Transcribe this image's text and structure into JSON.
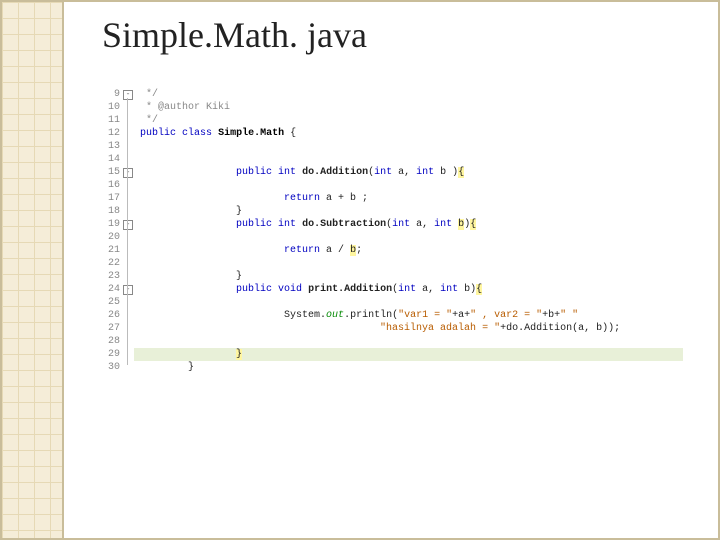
{
  "slide": {
    "title": "Simple.Math. java"
  },
  "editor": {
    "firstLine": 9,
    "lastLine": 30,
    "cursorLine": 29,
    "foldMarkers": [
      {
        "line": 9,
        "glyph": "-"
      },
      {
        "line": 15,
        "glyph": "-"
      },
      {
        "line": 19,
        "glyph": "-"
      },
      {
        "line": 24,
        "glyph": "-"
      }
    ],
    "lines": {
      "9": {
        "indent": 0,
        "tokens": [
          {
            "t": " */",
            "c": "cm"
          }
        ]
      },
      "10": {
        "indent": 0,
        "tokens": [
          {
            "t": " * @author Kiki",
            "c": "cm"
          }
        ]
      },
      "11": {
        "indent": 0,
        "tokens": [
          {
            "t": " */",
            "c": "cm"
          }
        ]
      },
      "12": {
        "indent": 0,
        "tokens": [
          {
            "t": "public",
            "c": "kw"
          },
          {
            "t": " "
          },
          {
            "t": "class",
            "c": "kw"
          },
          {
            "t": " "
          },
          {
            "t": "Simple.Math",
            "c": "typ"
          },
          {
            "t": " {"
          }
        ]
      },
      "13": {
        "indent": 0,
        "tokens": []
      },
      "14": {
        "indent": 0,
        "tokens": []
      },
      "15": {
        "indent": 2,
        "tokens": [
          {
            "t": "public",
            "c": "kw"
          },
          {
            "t": " "
          },
          {
            "t": "int",
            "c": "kw"
          },
          {
            "t": " "
          },
          {
            "t": "do.Addition",
            "c": "meth"
          },
          {
            "t": "("
          },
          {
            "t": "int",
            "c": "kw"
          },
          {
            "t": " a, "
          },
          {
            "t": "int",
            "c": "kw"
          },
          {
            "t": " b "
          },
          {
            "t": ")",
            "c": ""
          },
          {
            "t": "{",
            "c": "hl"
          }
        ]
      },
      "16": {
        "indent": 2,
        "tokens": []
      },
      "17": {
        "indent": 3,
        "tokens": [
          {
            "t": "return",
            "c": "kw"
          },
          {
            "t": " a + b ;"
          }
        ]
      },
      "18": {
        "indent": 2,
        "tokens": [
          {
            "t": "}"
          }
        ]
      },
      "19": {
        "indent": 2,
        "tokens": [
          {
            "t": "public",
            "c": "kw"
          },
          {
            "t": " "
          },
          {
            "t": "int",
            "c": "kw"
          },
          {
            "t": " "
          },
          {
            "t": "do.Subtraction",
            "c": "meth"
          },
          {
            "t": "("
          },
          {
            "t": "int",
            "c": "kw"
          },
          {
            "t": " a, "
          },
          {
            "t": "int",
            "c": "kw"
          },
          {
            "t": " "
          },
          {
            "t": "b",
            "c": "hl"
          },
          {
            "t": ")"
          },
          {
            "t": "{",
            "c": "hl"
          }
        ]
      },
      "20": {
        "indent": 2,
        "tokens": []
      },
      "21": {
        "indent": 3,
        "tokens": [
          {
            "t": "return",
            "c": "kw"
          },
          {
            "t": " a / "
          },
          {
            "t": "b",
            "c": "hl"
          },
          {
            "t": ";"
          }
        ]
      },
      "22": {
        "indent": 2,
        "tokens": []
      },
      "23": {
        "indent": 2,
        "tokens": [
          {
            "t": "}"
          }
        ]
      },
      "24": {
        "indent": 2,
        "tokens": [
          {
            "t": "public",
            "c": "kw"
          },
          {
            "t": " "
          },
          {
            "t": "void",
            "c": "kw"
          },
          {
            "t": " "
          },
          {
            "t": "print.Addition",
            "c": "meth"
          },
          {
            "t": "("
          },
          {
            "t": "int",
            "c": "kw"
          },
          {
            "t": " a, "
          },
          {
            "t": "int",
            "c": "kw"
          },
          {
            "t": " b)"
          },
          {
            "t": "{",
            "c": "hl"
          }
        ]
      },
      "25": {
        "indent": 2,
        "tokens": []
      },
      "26": {
        "indent": 3,
        "tokens": [
          {
            "t": "System."
          },
          {
            "t": "out",
            "c": "fld"
          },
          {
            "t": ".println("
          },
          {
            "t": "\"var1 = \"",
            "c": "str"
          },
          {
            "t": "+a+"
          },
          {
            "t": "\" , var2 = \"",
            "c": "str"
          },
          {
            "t": "+b+"
          },
          {
            "t": "\" \"",
            "c": "str"
          }
        ]
      },
      "27": {
        "indent": 5,
        "tokens": [
          {
            "t": "\"hasilnya adalah = \"",
            "c": "str"
          },
          {
            "t": "+do.Addition(a, b));"
          }
        ]
      },
      "28": {
        "indent": 2,
        "tokens": []
      },
      "29": {
        "indent": 2,
        "tokens": [
          {
            "t": "}",
            "c": "hl"
          }
        ]
      },
      "30": {
        "indent": 1,
        "tokens": [
          {
            "t": "}"
          }
        ]
      }
    }
  }
}
